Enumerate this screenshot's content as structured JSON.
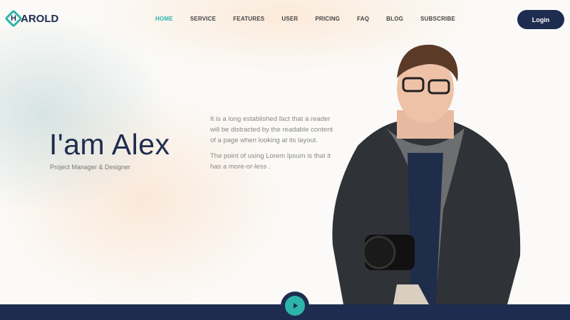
{
  "brand": {
    "logo_letter": "H",
    "logo_rest": "AROLD"
  },
  "nav": {
    "items": [
      "HOME",
      "SERVICE",
      "FEATURES",
      "USER",
      "PRICING",
      "FAQ",
      "BLOG",
      "SUBSCRIBE"
    ],
    "active": "HOME",
    "login": "Login"
  },
  "hero": {
    "title": "I'am Alex",
    "subtitle": "Project Manager & Designer",
    "paragraphs": [
      "It is a long established fact that a reader will be distracted by the readable content of a page when looking at its layout.",
      "The point of using Lorem Ipsum is that it has a more-or-less ."
    ]
  },
  "colors": {
    "accent": "#2cb5a9",
    "navy": "#1e2d4f"
  }
}
